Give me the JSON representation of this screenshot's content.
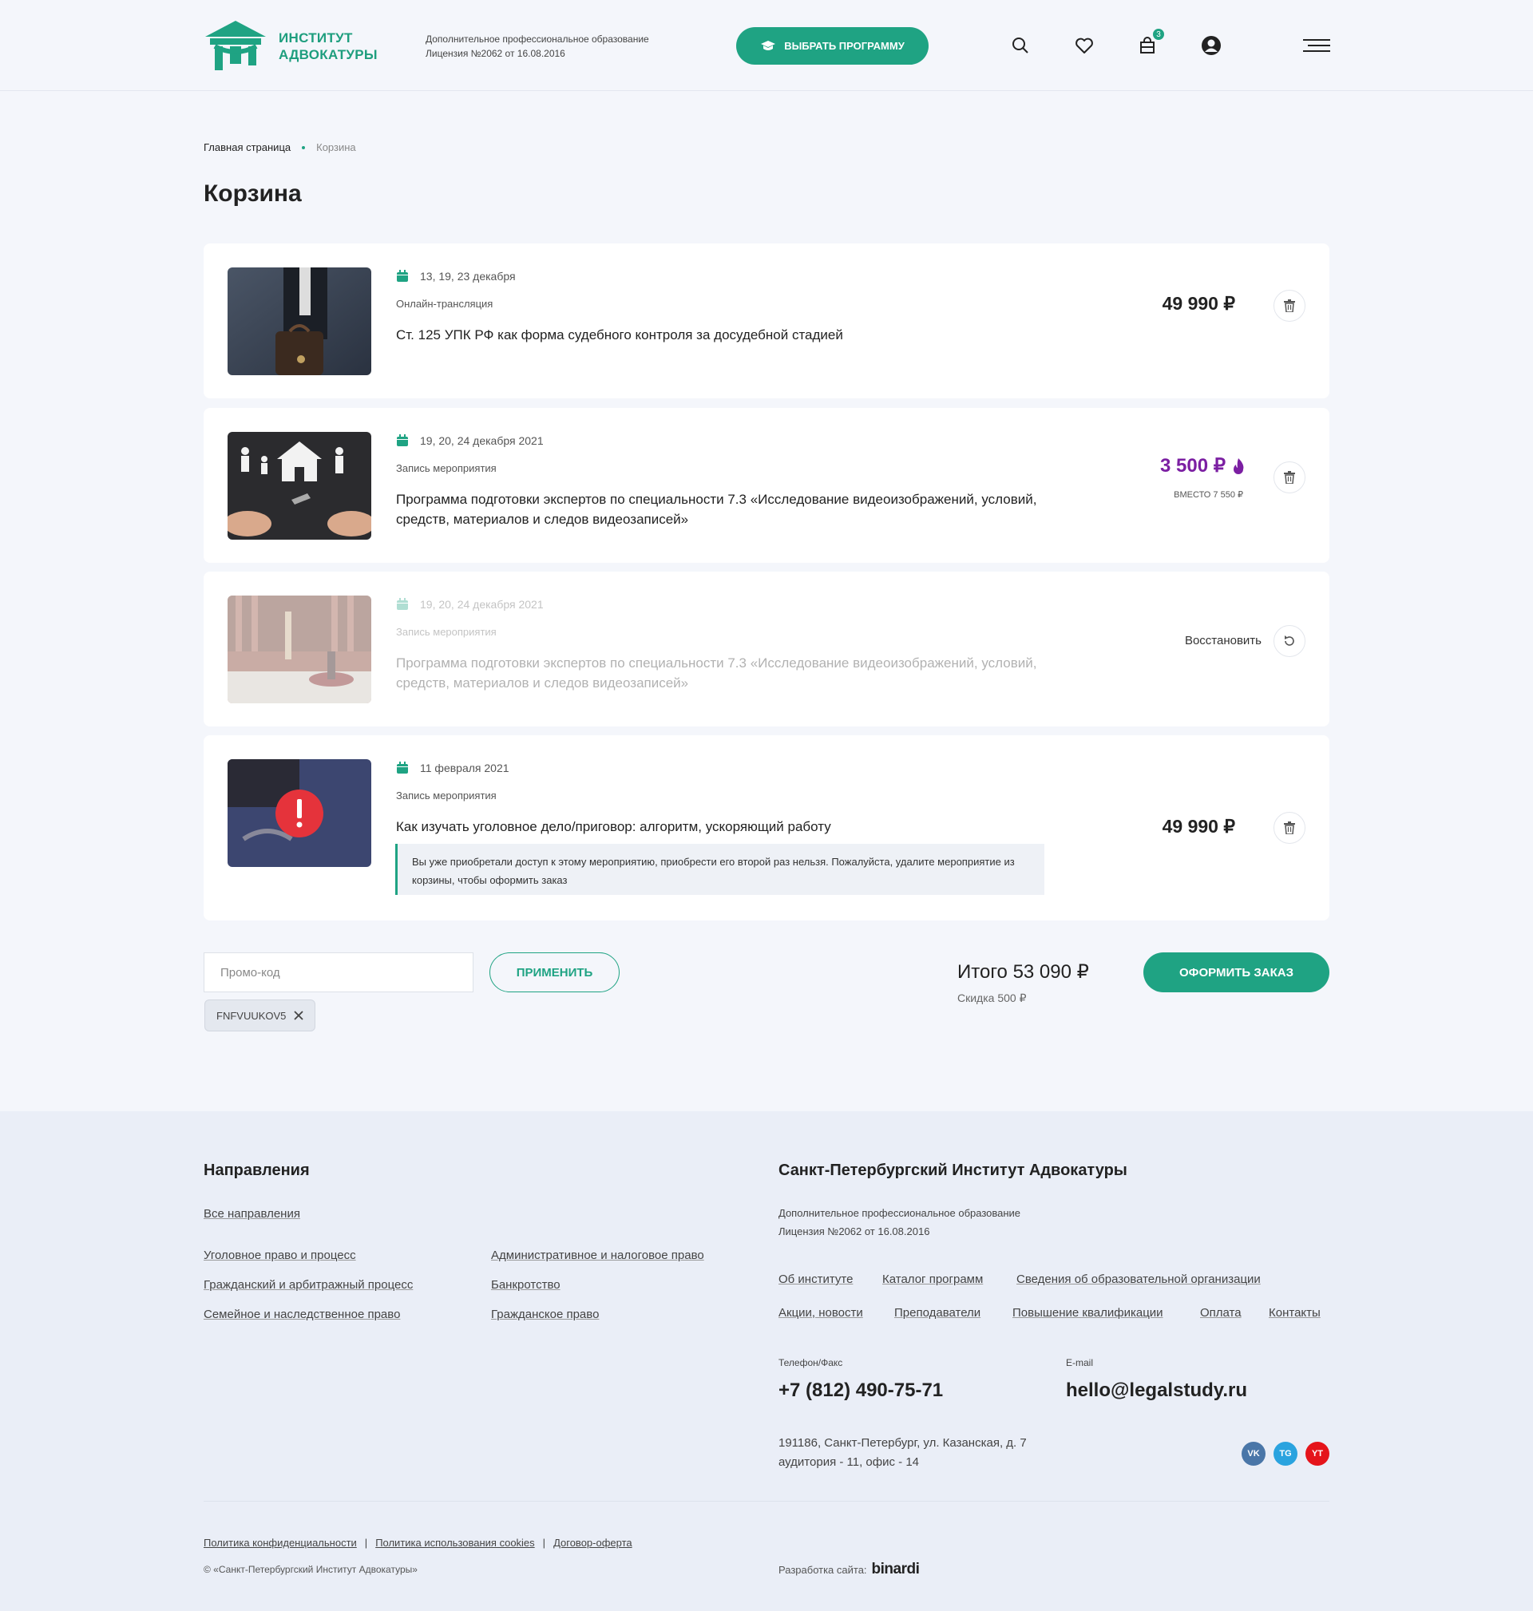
{
  "header": {
    "logo_line1": "ИНСТИТУТ",
    "logo_line2": "АДВОКАТУРЫ",
    "license_line1": "Дополнительное профессиональное образование",
    "license_line2": "Лицензия №2062 от 16.08.2016",
    "choose_program": "ВЫБРАТЬ ПРОГРАММУ",
    "cart_count": "3",
    "accent_color": "#1fa383"
  },
  "breadcrumb": {
    "home": "Главная страница",
    "current": "Корзина"
  },
  "page_title": "Корзина",
  "cart_items": [
    {
      "date": "13, 19, 23 декабря",
      "type": "Онлайн-трансляция",
      "title": "Ст. 125 УПК РФ как форма судебного контроля за досудебной стадией",
      "price": "49 990 ₽",
      "image": "businessman-briefcase-photo"
    },
    {
      "date": "19, 20, 24 декабря 2021",
      "type": "Запись мероприятия",
      "title": "Программа подготовки экспертов по специальности 7.3 «Исследование видеоизображений, условий, средств, материалов и следов видеозаписей»",
      "price": "3 500 ₽",
      "old_price": "ВМЕСТО 7 550 ₽",
      "image": "family-house-keys-photo",
      "sale_color": "#7b1fa2"
    },
    {
      "date": "19, 20, 24 декабря 2021",
      "type": "Запись мероприятия",
      "title": "Программа подготовки экспертов по специальности 7.3 «Исследование видеоизображений, условий, средств, материалов и следов видеозаписей»",
      "restore": "Восстановить",
      "image": "justice-statue-gavel-photo"
    },
    {
      "date": "11 февраля 2021",
      "type": "Запись мероприятия",
      "title": "Как изучать уголовное дело/приговор: алгоритм, ускоряющий работу",
      "price": "49 990 ₽",
      "warning": "Вы уже приобретали доступ к этому мероприятию, приобрести его второй раз нельзя. Пожалуйста, удалите мероприятие из корзины, чтобы оформить заказ",
      "image": "handcuffs-books-photo"
    }
  ],
  "promo": {
    "placeholder": "Промо-код",
    "apply": "ПРИМЕНИТЬ",
    "applied_code": "FNFVUUKOV5"
  },
  "summary": {
    "total": "Итого 53 090 ₽",
    "discount": "Скидка 500 ₽",
    "order_button": "ОФОРМИТЬ ЗАКАЗ"
  },
  "footer": {
    "directions_title": "Направления",
    "all_directions": "Все направления",
    "directions": [
      "Уголовное право и процесс",
      "Гражданский и арбитражный процесс",
      "Семейное и наследственное право",
      "Административное и налоговое право",
      "Банкротство",
      "Гражданское право"
    ],
    "institute_title": "Санкт-Петербургский Институт Адвокатуры",
    "license_line1": "Дополнительное профессиональное образование",
    "license_line2": "Лицензия №2062 от 16.08.2016",
    "links": [
      "Об институте",
      "Каталог программ",
      "Сведения об образовательной организации",
      "Акции, новости",
      "Преподаватели",
      "Повышение квалификации",
      "Оплата",
      "Контакты"
    ],
    "phone_label": "Телефон/Факс",
    "phone": "+7 (812) 490-75-71",
    "email_label": "E-mail",
    "email": "hello@legalstudy.ru",
    "address_line1": "191186, Санкт-Петербург, ул. Казанская, д. 7",
    "address_line2": "аудитория - 11, офис - 14",
    "social": [
      {
        "name": "vk",
        "label": "VK",
        "color": "#4a76a8"
      },
      {
        "name": "telegram",
        "label": "TG",
        "color": "#2aa3df"
      },
      {
        "name": "youtube",
        "label": "YT",
        "color": "#e5141b"
      }
    ],
    "policy_links": [
      "Политика конфиденциальности",
      "Политика использования cookies",
      "Договор-оферта"
    ],
    "copyright": "© «Санкт-Петербургский Институт Адвокатуры»",
    "dev_label": "Разработка сайта:",
    "dev_name": "binardi"
  }
}
